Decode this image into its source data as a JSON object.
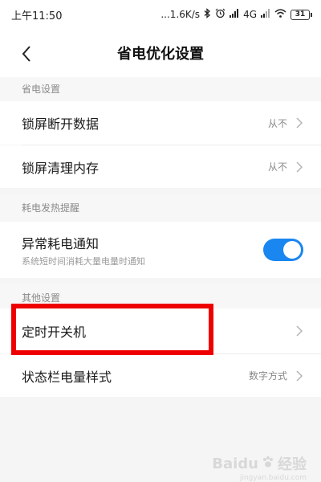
{
  "status_bar": {
    "time": "上午11:50",
    "net_speed": "...1.6K/s",
    "network": "4G",
    "battery": "31"
  },
  "header": {
    "title": "省电优化设置"
  },
  "sections": [
    {
      "title": "省电设置",
      "items": [
        {
          "label": "锁屏断开数据",
          "value": "从不"
        },
        {
          "label": "锁屏清理内存",
          "value": "从不"
        }
      ]
    },
    {
      "title": "耗电发热提醒",
      "items": [
        {
          "label": "异常耗电通知",
          "sublabel": "系统短时间消耗大量电量时通知",
          "toggle_on": true
        }
      ]
    },
    {
      "title": "其他设置",
      "items": [
        {
          "label": "定时开关机",
          "value": ""
        },
        {
          "label": "状态栏电量样式",
          "value": "数字方式"
        }
      ]
    }
  ],
  "watermark": {
    "brand": "Baidu",
    "text": "经验",
    "sub": "jingyan.baidu.com"
  }
}
